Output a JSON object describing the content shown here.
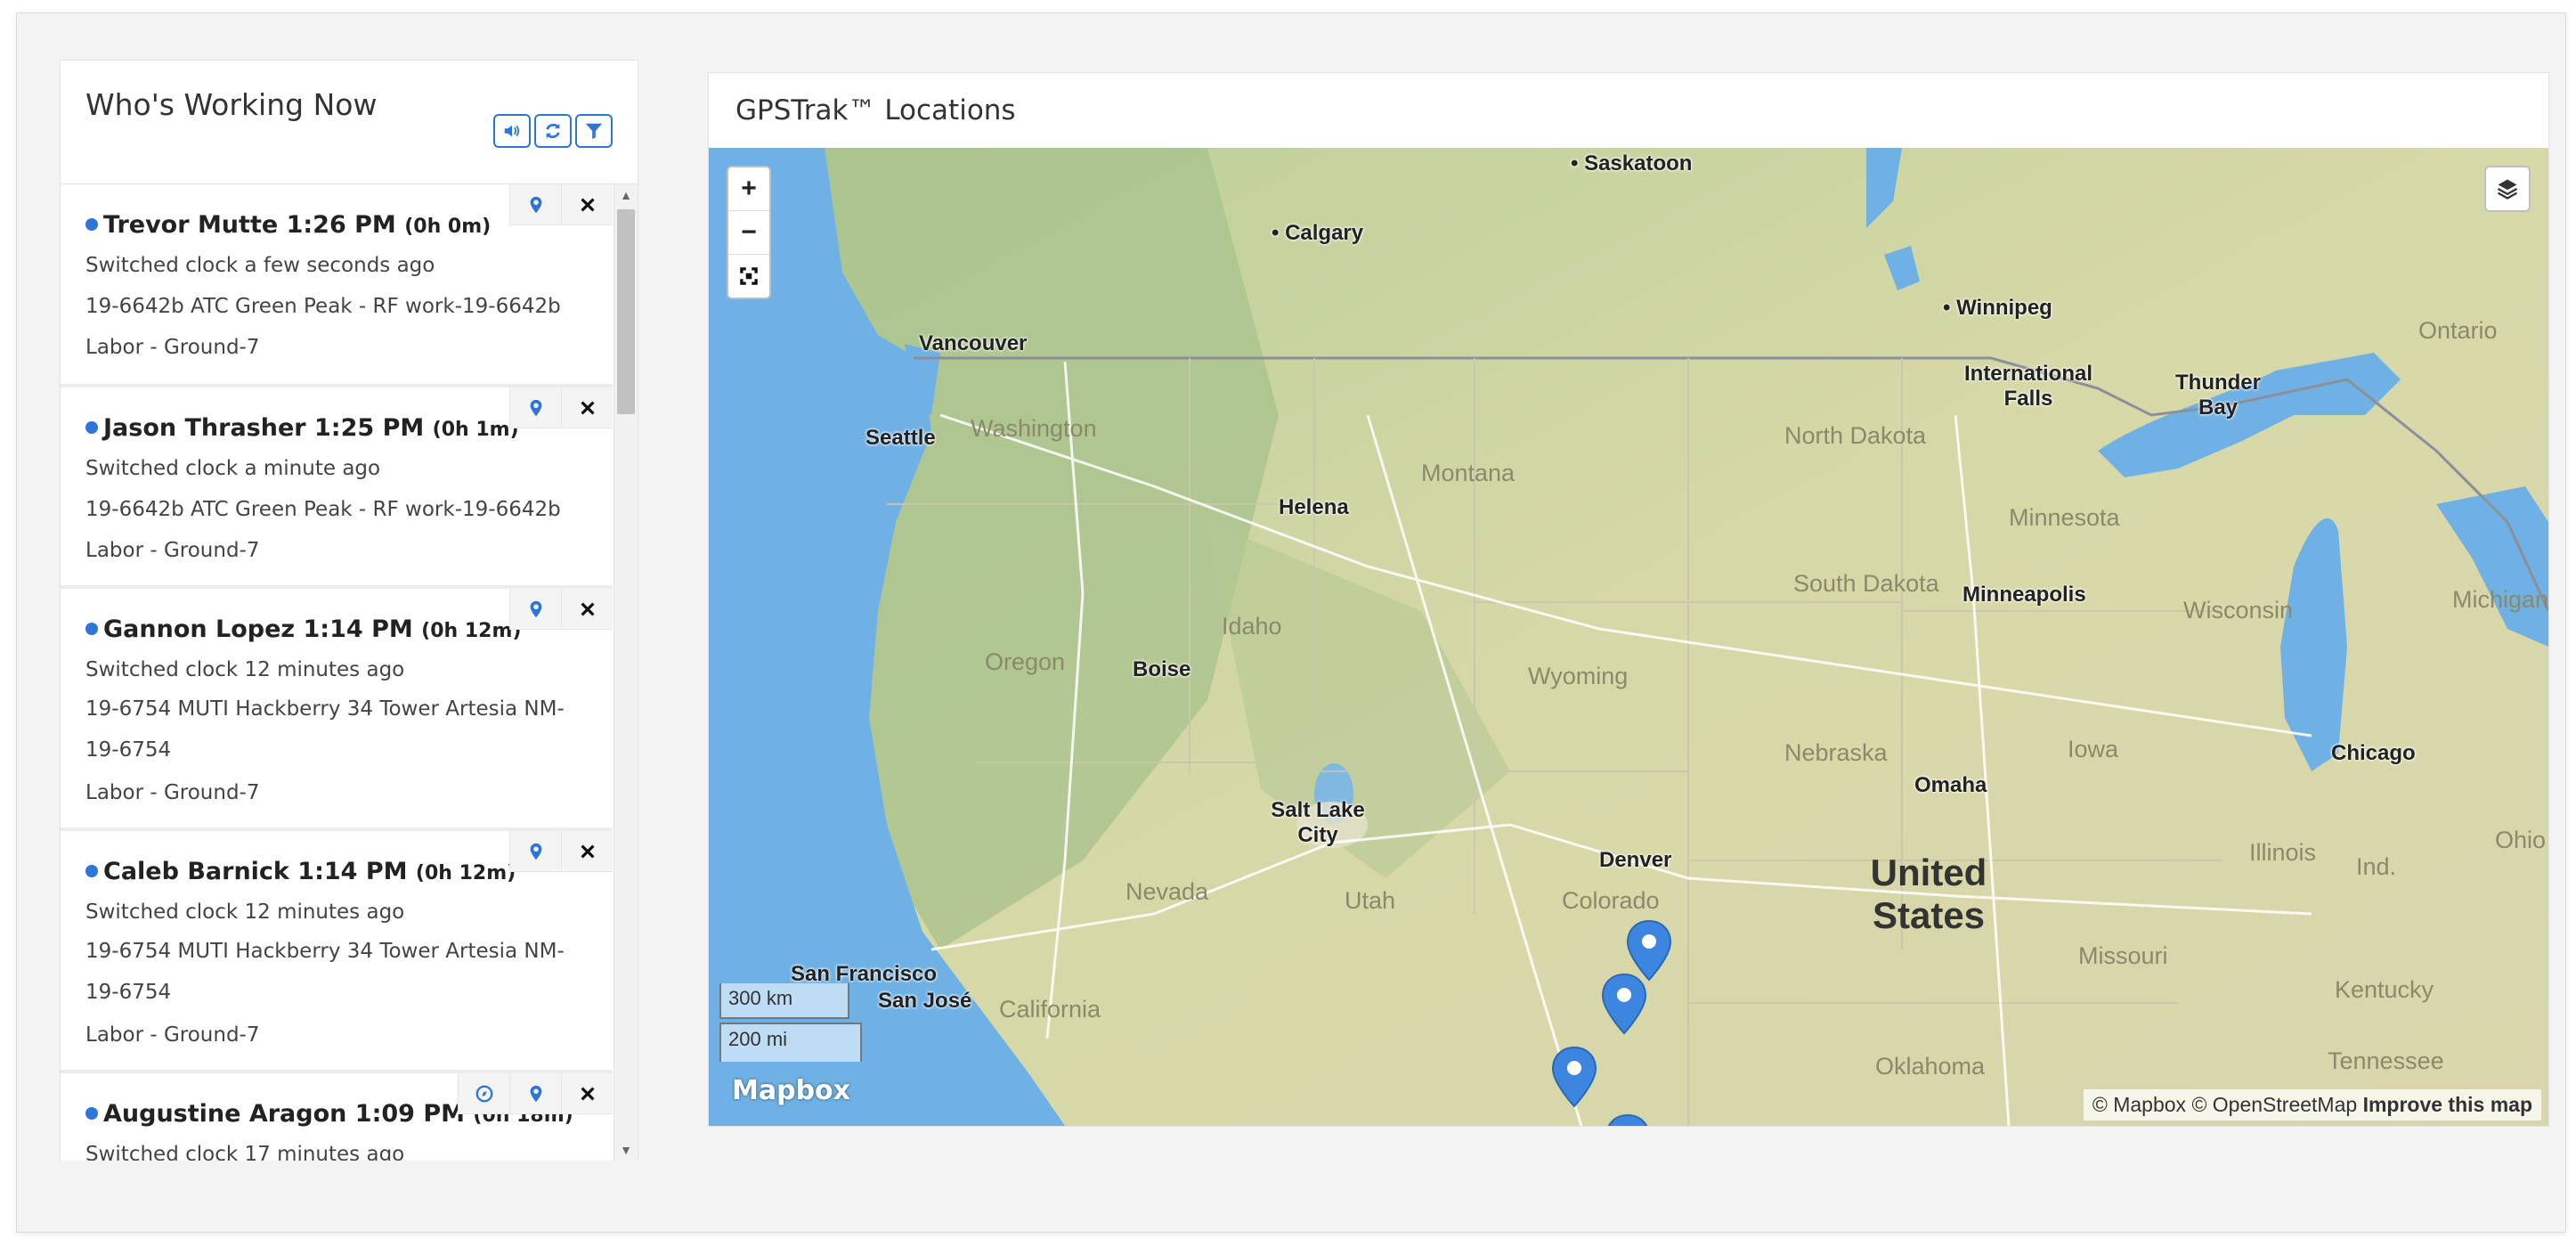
{
  "left_panel": {
    "title": "Who's Working Now",
    "toolbar": [
      "speaker-icon",
      "refresh-icon",
      "filter-icon"
    ],
    "workers": [
      {
        "name": "Trevor Mutte",
        "time": "1:26 PM",
        "duration": "(0h 0m)",
        "status": "Switched clock a few seconds ago",
        "job": "19-6642b ATC Green Peak - RF work-19-6642b",
        "task": "Labor - Ground-7"
      },
      {
        "name": "Jason Thrasher",
        "time": "1:25 PM",
        "duration": "(0h 1m)",
        "status": "Switched clock a minute ago",
        "job": "19-6642b ATC Green Peak - RF work-19-6642b",
        "task": "Labor - Ground-7"
      },
      {
        "name": "Gannon Lopez",
        "time": "1:14 PM",
        "duration": "(0h 12m)",
        "status": "Switched clock 12 minutes ago",
        "job": "19-6754 MUTI Hackberry 34 Tower Artesia NM-19-6754",
        "task": "Labor - Ground-7"
      },
      {
        "name": "Caleb Barnick",
        "time": "1:14 PM",
        "duration": "(0h 12m)",
        "status": "Switched clock 12 minutes ago",
        "job": "19-6754 MUTI Hackberry 34 Tower Artesia NM-19-6754",
        "task": "Labor - Ground-7"
      },
      {
        "name": "Augustine Aragon",
        "time": "1:09 PM",
        "duration": "(0h 18m)",
        "status": "Switched clock 17 minutes ago",
        "job": "",
        "task": ""
      }
    ]
  },
  "map_panel": {
    "title": "GPSTrak™ Locations",
    "zoom_in": "+",
    "zoom_out": "−",
    "scale_km": "300 km",
    "scale_mi": "200 mi",
    "logo": "Mapbox",
    "attribution": {
      "mapbox": "© Mapbox",
      "osm": "© OpenStreetMap",
      "improve": "Improve this map"
    },
    "cities": [
      "Saskatoon",
      "Calgary",
      "Winnipeg",
      "Vancouver",
      "International Falls",
      "Thunder Bay",
      "Seattle",
      "Helena",
      "Minneapolis",
      "Boise",
      "Chicago",
      "Omaha",
      "Salt Lake City",
      "Denver",
      "San Francisco",
      "San José"
    ],
    "regions": [
      "Washington",
      "Ontario",
      "North Dakota",
      "Montana",
      "Minnesota",
      "South Dakota",
      "Wisconsin",
      "Michigan",
      "Oregon",
      "Idaho",
      "Wyoming",
      "Iowa",
      "Nebraska",
      "Illinois",
      "Ohio",
      "Ind.",
      "Nevada",
      "Utah",
      "Colorado",
      "Missouri",
      "Kentucky",
      "California",
      "Oklahoma",
      "Tennessee"
    ],
    "country": "United States",
    "markers": 4,
    "colors": {
      "accent": "#2e75d9",
      "water": "#6fb1e4"
    }
  }
}
